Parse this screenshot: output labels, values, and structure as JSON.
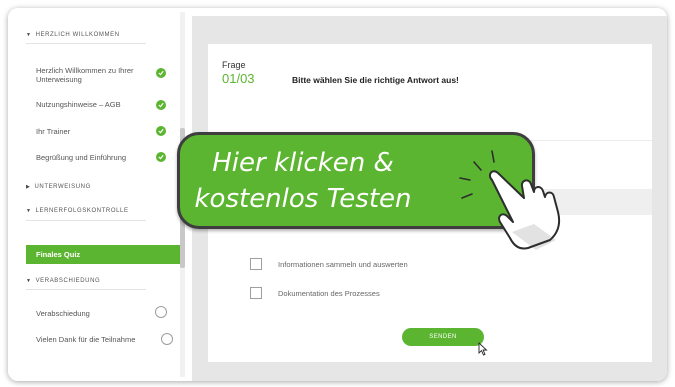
{
  "sidebar": {
    "sections": [
      {
        "label": "HERZLICH WILLKOMMEN"
      },
      {
        "label": "UNTERWEISUNG"
      },
      {
        "label": "LERNERFOLGSKONTROLLE"
      },
      {
        "label": "VERABSCHIEDUNG"
      }
    ],
    "welcome_items": [
      {
        "label": "Herzlich Willkommen zu Ihrer Unterweisung"
      },
      {
        "label": "Nutzungshinweise – AGB"
      },
      {
        "label": "Ihr Trainer"
      },
      {
        "label": "Begrüßung und Einführung"
      }
    ],
    "active_item": "Finales Quiz",
    "farewell_items": [
      {
        "label": "Verabschiedung"
      },
      {
        "label": "Vielen Dank für die Teilnahme"
      }
    ]
  },
  "quiz": {
    "frage_label": "Frage",
    "frage_number": "01/03",
    "question": "Bitte wählen Sie die richtige Antwort aus!",
    "options": [
      {
        "label": "Informationen sammeln und auswerten"
      },
      {
        "label": "Dokumentation des Prozesses"
      }
    ],
    "send_label": "SENDEN"
  },
  "cta": {
    "line1": "Hier klicken &",
    "line2": "kostenlos Testen"
  },
  "colors": {
    "accent": "#5cb531",
    "cta_border": "#3e3e3e",
    "main_bg": "#e6e6e6"
  },
  "icons": {
    "check": "check-circle-icon",
    "radio": "radio-circle-icon",
    "hand": "pointing-hand-icon",
    "cursor": "mouse-pointer-icon"
  }
}
